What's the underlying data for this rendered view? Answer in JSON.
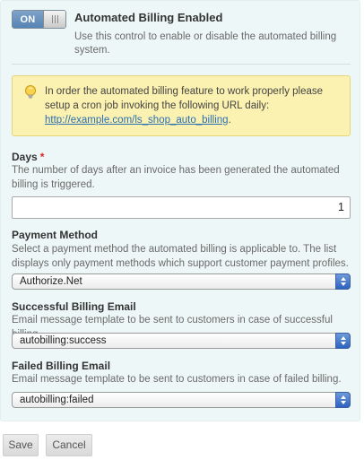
{
  "toggle": {
    "state_label": "ON",
    "enabled": true,
    "title": "Automated Billing Enabled",
    "help": "Use this control to enable or disable the automated billing system."
  },
  "hint": {
    "icon": "lightbulb-icon",
    "text": "In order the automated billing feature to work properly please setup a cron job invoking the following URL daily:",
    "link": "http://example.com/ls_shop_auto_billing",
    "link_suffix": "."
  },
  "days": {
    "label": "Days",
    "required_mark": "*",
    "help": "The number of days after an invoice has been generated the automated billing is triggered.",
    "value": "1"
  },
  "payment_method": {
    "label": "Payment Method",
    "help": "Select a payment method the automated billing is applicable to. The list displays only payment methods which support customer payment profiles.",
    "selected": "Authorize.Net"
  },
  "success_email": {
    "label": "Successful Billing Email",
    "help": "Email message template to be sent to customers in case of successful billing.",
    "selected": "autobilling:success"
  },
  "failed_email": {
    "label": "Failed Billing Email",
    "help": "Email message template to be sent to customers in case of failed billing.",
    "selected": "autobilling:failed"
  },
  "buttons": {
    "save": "Save",
    "cancel": "Cancel"
  },
  "colors": {
    "panel_bg": "#eef7f7",
    "hint_bg": "#fbf1b0",
    "toggle_on": "#5b88b8",
    "link": "#2a6fb3",
    "required": "#dd2222"
  }
}
